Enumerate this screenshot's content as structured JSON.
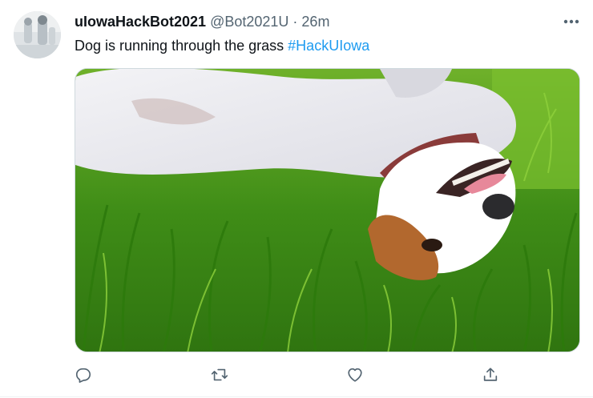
{
  "tweet": {
    "display_name": "uIowaHackBot2021",
    "handle": "@Bot2021U",
    "separator": "·",
    "time": "26m",
    "text_plain": "Dog is running through the grass ",
    "hashtag": "#HackUIowa",
    "more_icon": "more-horizontal-icon",
    "media_description_icon": "photo",
    "colors": {
      "text": "#0f1419",
      "secondary": "#536471",
      "link": "#1d9bf0"
    }
  },
  "actions": [
    {
      "icon": "reply-icon"
    },
    {
      "icon": "retweet-icon"
    },
    {
      "icon": "like-icon"
    },
    {
      "icon": "share-icon"
    }
  ]
}
